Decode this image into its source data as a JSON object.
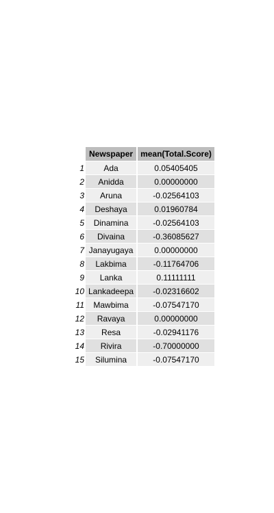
{
  "table": {
    "headers": [
      "Newspaper",
      "mean(Total.Score)"
    ],
    "rows": [
      {
        "index": "1",
        "newspaper": "Ada",
        "score": "0.05405405"
      },
      {
        "index": "2",
        "newspaper": "Anidda",
        "score": "0.00000000"
      },
      {
        "index": "3",
        "newspaper": "Aruna",
        "score": "-0.02564103"
      },
      {
        "index": "4",
        "newspaper": "Deshaya",
        "score": "0.01960784"
      },
      {
        "index": "5",
        "newspaper": "Dinamina",
        "score": "-0.02564103"
      },
      {
        "index": "6",
        "newspaper": "Divaina",
        "score": "-0.36085627"
      },
      {
        "index": "7",
        "newspaper": "Janayugaya",
        "score": "0.00000000"
      },
      {
        "index": "8",
        "newspaper": "Lakbima",
        "score": "-0.11764706"
      },
      {
        "index": "9",
        "newspaper": "Lanka",
        "score": "0.11111111"
      },
      {
        "index": "10",
        "newspaper": "Lankadeepa",
        "score": "-0.02316602"
      },
      {
        "index": "11",
        "newspaper": "Mawbima",
        "score": "-0.07547170"
      },
      {
        "index": "12",
        "newspaper": "Ravaya",
        "score": "0.00000000"
      },
      {
        "index": "13",
        "newspaper": "Resa",
        "score": "-0.02941176"
      },
      {
        "index": "14",
        "newspaper": "Rivira",
        "score": "-0.70000000"
      },
      {
        "index": "15",
        "newspaper": "Silumina",
        "score": "-0.07547170"
      }
    ]
  },
  "colors": {
    "header_bg": "#bdbdbd",
    "row_odd_bg": "#efefef",
    "row_even_bg": "#e0e0e0"
  }
}
